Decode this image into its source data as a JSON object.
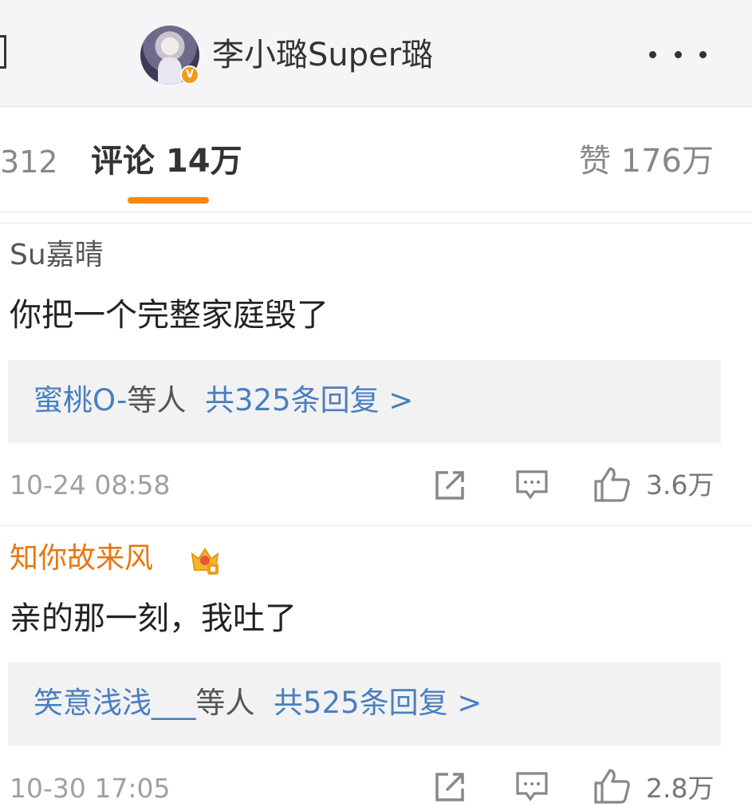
{
  "header": {
    "account_name": "李小璐Super璐",
    "verified_mark": "V"
  },
  "tabs": {
    "partial_count": "312",
    "comments": "评论 14万",
    "likes": "赞 176万"
  },
  "comments": [
    {
      "user": "Su嘉晴",
      "user_color": "#555555",
      "text": "你把一个完整家庭毁了",
      "reply_users": "蜜桃O-",
      "reply_mid": "等人",
      "reply_total": "共325条回复 >",
      "time": "10-24 08:58",
      "likes": "3.6万"
    },
    {
      "user": "知你故来风",
      "user_color": "#e8760f",
      "text": "亲的那一刻，我吐了",
      "reply_users": "笑意浅浅___",
      "reply_mid": "等人",
      "reply_total": "共525条回复 >",
      "time": "10-30 17:05",
      "likes": "2.8万"
    }
  ],
  "icons": [
    "share-icon",
    "comment-icon",
    "like-icon",
    "vip-crown-icon",
    "more-icon",
    "back-icon"
  ],
  "colors": {
    "accent": "#f7870f",
    "link": "#4a7fc0",
    "vip": "#e8760f"
  }
}
